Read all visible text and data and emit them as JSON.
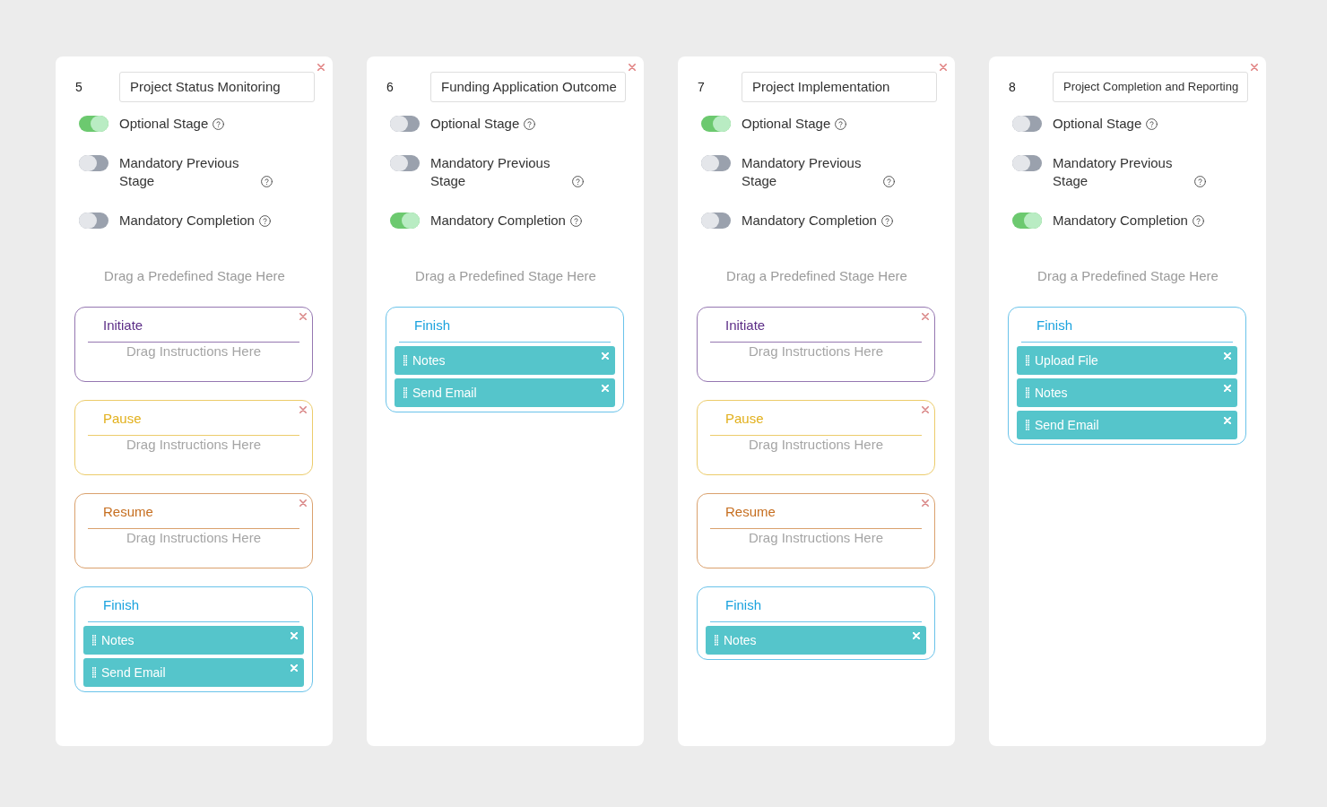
{
  "columns": [
    {
      "number": "5",
      "title": "Project Status Monitoring",
      "toggles": [
        {
          "label": "Optional Stage",
          "on": true
        },
        {
          "label": "Mandatory Previous Stage",
          "on": false
        },
        {
          "label": "Mandatory Completion",
          "on": false
        }
      ],
      "drop_hint": "Drag a Predefined Stage Here",
      "stages": [
        {
          "name": "Initiate",
          "color": "#5c2d87",
          "removable": true,
          "drop_hint": "Drag Instructions Here"
        },
        {
          "name": "Pause",
          "color": "#e2b01c",
          "removable": true,
          "drop_hint": "Drag Instructions Here"
        },
        {
          "name": "Resume",
          "color": "#c66e1f",
          "removable": true,
          "drop_hint": "Drag Instructions Here"
        },
        {
          "name": "Finish",
          "color": "#1aa2de",
          "removable": false,
          "items": [
            {
              "label": "Notes"
            },
            {
              "label": "Send Email"
            }
          ]
        }
      ]
    },
    {
      "number": "6",
      "title": "Funding Application Outcome",
      "toggles": [
        {
          "label": "Optional Stage",
          "on": false
        },
        {
          "label": "Mandatory Previous Stage",
          "on": false
        },
        {
          "label": "Mandatory Completion",
          "on": true
        }
      ],
      "drop_hint": "Drag a Predefined Stage Here",
      "stages": [
        {
          "name": "Finish",
          "color": "#1aa2de",
          "removable": false,
          "items": [
            {
              "label": "Notes"
            },
            {
              "label": "Send Email"
            }
          ]
        }
      ]
    },
    {
      "number": "7",
      "title": "Project Implementation",
      "toggles": [
        {
          "label": "Optional Stage",
          "on": true
        },
        {
          "label": "Mandatory Previous Stage",
          "on": false
        },
        {
          "label": "Mandatory Completion",
          "on": false
        }
      ],
      "drop_hint": "Drag a Predefined Stage Here",
      "stages": [
        {
          "name": "Initiate",
          "color": "#5c2d87",
          "removable": true,
          "drop_hint": "Drag Instructions Here"
        },
        {
          "name": "Pause",
          "color": "#e2b01c",
          "removable": true,
          "drop_hint": "Drag Instructions Here"
        },
        {
          "name": "Resume",
          "color": "#c66e1f",
          "removable": true,
          "drop_hint": "Drag Instructions Here"
        },
        {
          "name": "Finish",
          "color": "#1aa2de",
          "removable": false,
          "items": [
            {
              "label": "Notes"
            }
          ]
        }
      ]
    },
    {
      "number": "8",
      "title": "Project Completion and Reporting",
      "toggles": [
        {
          "label": "Optional Stage",
          "on": false
        },
        {
          "label": "Mandatory Previous Stage",
          "on": false
        },
        {
          "label": "Mandatory Completion",
          "on": true
        }
      ],
      "drop_hint": "Drag a Predefined Stage Here",
      "stages": [
        {
          "name": "Finish",
          "color": "#1aa2de",
          "removable": false,
          "items": [
            {
              "label": "Upload File"
            },
            {
              "label": "Notes"
            },
            {
              "label": "Send Email"
            }
          ]
        }
      ]
    }
  ]
}
